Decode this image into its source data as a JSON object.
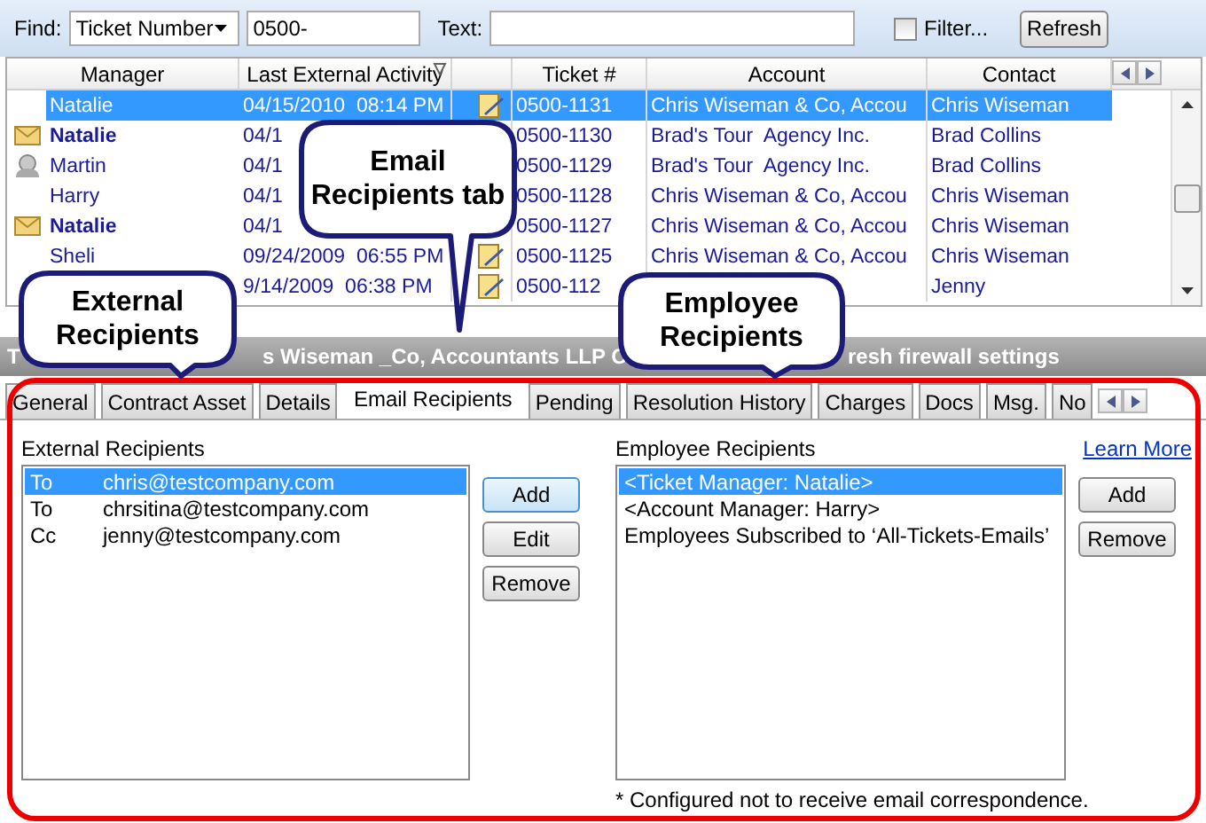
{
  "toolbar": {
    "find_label": "Find:",
    "find_field": "Ticket Number",
    "search_value": "0500-",
    "text_label": "Text:",
    "filter": {
      "label": "Filter...",
      "checked": false
    },
    "refresh_button": "Refresh"
  },
  "grid": {
    "columns": {
      "manager": "Manager",
      "date": "Last External Activity",
      "ticket": "Ticket #",
      "account": "Account",
      "contact": "Contact"
    },
    "rows": [
      {
        "kind": "plain",
        "manager": "Natalie",
        "bold": false,
        "date": "04/15/2010  08:14 PM",
        "attachment": true,
        "ticket": "0500-1131",
        "account": "Chris Wiseman & Co, Accou",
        "contact": "Chris Wiseman",
        "selected": true
      },
      {
        "kind": "envelope",
        "manager": "Natalie",
        "bold": true,
        "date": "04/1",
        "ticket": "0500-1130",
        "account": "Brad's Tour  Agency Inc.",
        "contact": "Brad Collins",
        "selected": false
      },
      {
        "kind": "person",
        "manager": "Martin",
        "bold": false,
        "date": "04/1",
        "ticket": "0500-1129",
        "account": "Brad's Tour  Agency Inc.",
        "contact": "Brad Collins",
        "selected": false
      },
      {
        "kind": "plain",
        "manager": "Harry",
        "bold": false,
        "date": "04/1",
        "ticket": "0500-1128",
        "account": "Chris Wiseman & Co, Accou",
        "contact": "Chris Wiseman",
        "selected": false
      },
      {
        "kind": "envelope",
        "manager": "Natalie",
        "bold": true,
        "date": "04/1",
        "ticket": "0500-1127",
        "account": "Chris Wiseman & Co, Accou",
        "contact": "Chris Wiseman",
        "selected": false
      },
      {
        "kind": "plain",
        "manager": "Sheli",
        "bold": false,
        "date": "09/24/2009  06:55 PM",
        "attachment": true,
        "ticket": "0500-1125",
        "account": "Chris Wiseman & Co, Accou",
        "contact": "Chris Wiseman",
        "selected": false
      },
      {
        "kind": "plain",
        "date": "9/14/2009  06:38 PM",
        "attachment": true,
        "ticket": "0500-112",
        "contact": "Jenny",
        "selected": false
      }
    ]
  },
  "title_bar": [
    "T",
    "s Wiseman _Co, Accountants LLP C",
    "resh firewall settings"
  ],
  "tabs": [
    {
      "label": "General",
      "selected": false
    },
    {
      "label": "Contract Asset",
      "selected": false
    },
    {
      "label": "Details",
      "selected": false
    },
    {
      "label": "Email Recipients",
      "selected": true
    },
    {
      "label": "Pending",
      "selected": false
    },
    {
      "label": "Resolution History",
      "selected": false
    },
    {
      "label": "Charges",
      "selected": false
    },
    {
      "label": "Docs",
      "selected": false
    },
    {
      "label": "Msg.",
      "selected": false
    },
    {
      "label": "No",
      "selected": false
    }
  ],
  "external": {
    "label": "External Recipients",
    "recipients": [
      {
        "type": "To",
        "email": "chris@testcompany.com",
        "selected": true
      },
      {
        "type": "To",
        "email": "chrsitina@testcompany.com",
        "selected": false
      },
      {
        "type": "Cc",
        "email": "jenny@testcompany.com",
        "selected": false
      }
    ],
    "buttons": [
      "Add",
      "Edit",
      "Remove"
    ]
  },
  "employee": {
    "label": "Employee Recipients",
    "learn_more": "Learn More",
    "recipients": [
      {
        "text": "<Ticket Manager: Natalie>",
        "selected": true
      },
      {
        "text": "<Account Manager: Harry>",
        "selected": false
      },
      {
        "text": "Employees Subscribed to ‘All-Tickets-Emails’",
        "selected": false
      }
    ],
    "buttons": [
      "Add",
      "Remove"
    ],
    "note": "* Configured not to receive email correspondence."
  },
  "callouts": [
    {
      "lines": [
        "Email",
        "Recipients tab"
      ]
    },
    {
      "lines": [
        "External",
        "Recipients"
      ]
    },
    {
      "lines": [
        "Employee",
        "Recipients"
      ]
    }
  ]
}
